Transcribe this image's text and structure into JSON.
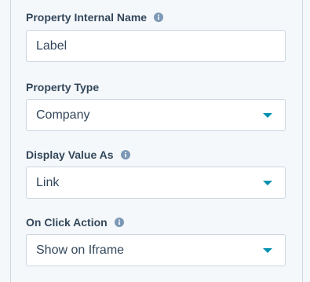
{
  "fields": [
    {
      "label": "Property Internal Name",
      "value": "Label",
      "type": "text",
      "has_info": true,
      "info_icon": "info-circle-icon"
    },
    {
      "label": "Property Type",
      "value": "Company",
      "type": "select",
      "has_info": false
    },
    {
      "label": "Display Value As",
      "value": "Link",
      "type": "select",
      "has_info": true,
      "info_icon": "info-circle-icon"
    },
    {
      "label": "On Click Action",
      "value": "Show on Iframe",
      "type": "select",
      "has_info": true,
      "info_icon": "info-circle-icon"
    }
  ],
  "colors": {
    "label_text": "#33475b",
    "input_border": "#cbd6e2",
    "caret": "#0091ae",
    "info_icon": "#7c98b6",
    "panel_bg": "#f5f8fa"
  }
}
